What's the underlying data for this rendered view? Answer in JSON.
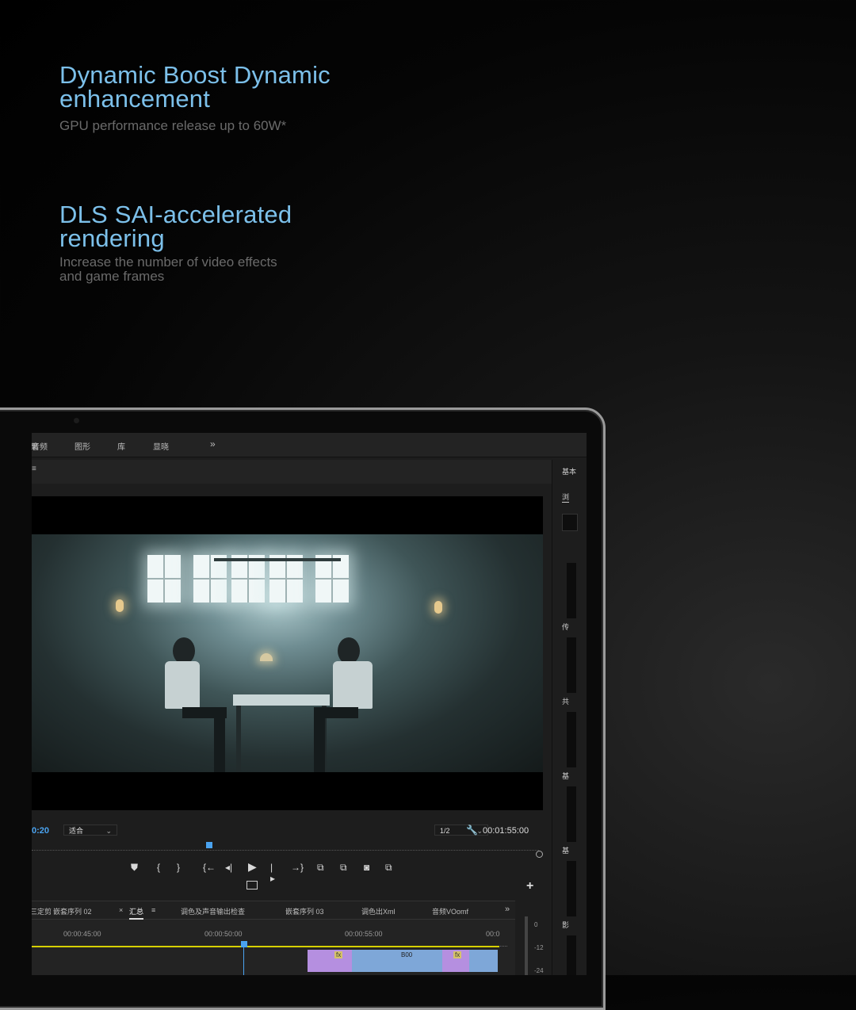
{
  "hero": [
    {
      "title": "Dynamic Boost Dynamic enhancement",
      "subtitle": "GPU performance release up to 60W*"
    },
    {
      "title": "DLS SAI-accelerated rendering",
      "subtitle": "Increase the number of video effects and game frames"
    }
  ],
  "app": {
    "menu": [
      "果",
      "音频",
      "图形",
      "库",
      "显晓",
      "»"
    ],
    "panel_menu_icon": "≡",
    "monitor": {
      "timecode_left": "0:20",
      "fit_select": "适合",
      "res_select": "1/2",
      "timecode_right": "00:01:55:00"
    },
    "transport_icons": [
      "marker-icon",
      "mark-in-icon",
      "mark-out-icon",
      "go-to-in-icon",
      "step-back-icon",
      "play-icon",
      "step-forward-icon",
      "go-to-out-icon",
      "lift-icon",
      "extract-icon",
      "camera-icon",
      "compare-icon"
    ],
    "transport_glyphs": [
      "⛊",
      "{",
      "}",
      "{←",
      "◂|",
      "▶",
      "|▸",
      "→}",
      "⧉",
      "⧉",
      "◙",
      "⧉"
    ],
    "add_button": "+",
    "right_panel": [
      "基本",
      "浏",
      "传",
      "共",
      "基",
      "基",
      "影"
    ],
    "timeline": {
      "tabs": [
        "三定剪",
        "嵌套序列 02",
        "汇总",
        "调色及声音输出检查",
        "嵌套序列 03",
        "调色出Xml",
        "音频VOomf"
      ],
      "active_tab": "汇总",
      "close_glyph": "×",
      "tab_menu": "≡",
      "more": "»",
      "ruler": [
        "00:00:45:00",
        "00:00:50:00",
        "00:00:55:00",
        "00:0"
      ],
      "clip_label": "B00",
      "fx_label": "fx"
    },
    "meter": [
      "0",
      "-12",
      "-24"
    ]
  },
  "colors": {
    "accent_title": "#7cc0ea",
    "timecode_blue": "#4aa3f0",
    "clip_purple": "#b58fe0",
    "clip_blue": "#7ea7d8",
    "timeline_yellow": "#d6d000"
  }
}
